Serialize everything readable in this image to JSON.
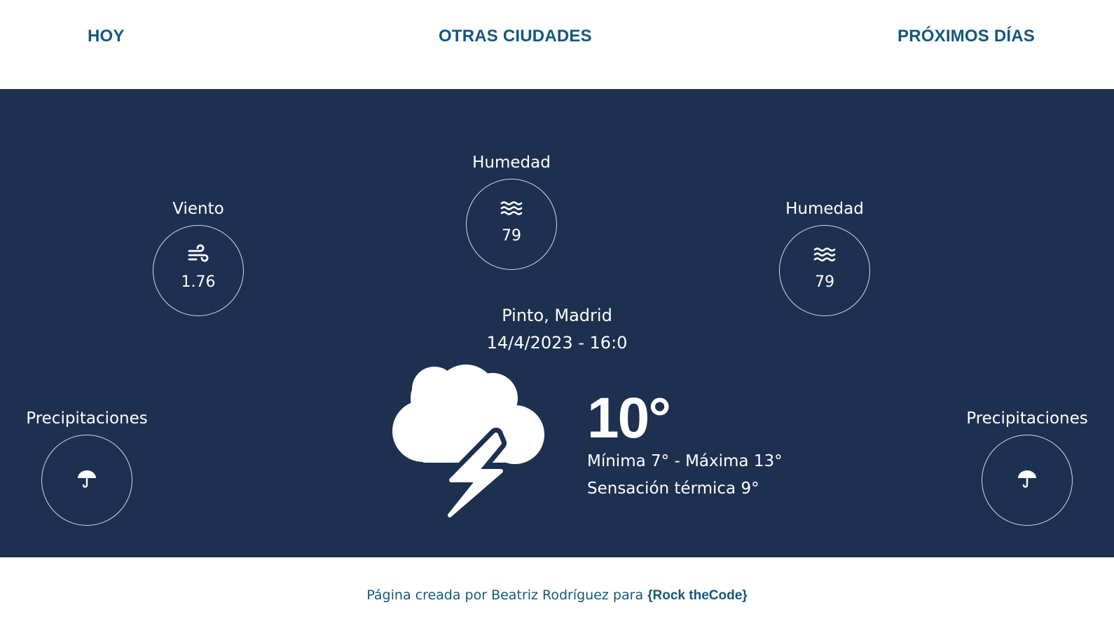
{
  "nav": {
    "today": "HOY",
    "other_cities": "OTRAS CIUDADES",
    "next_days": "PRÓXIMOS DÍAS"
  },
  "stats": {
    "wind": {
      "label": "Viento",
      "value": "1.76",
      "icon": "wind-icon"
    },
    "humidity_center": {
      "label": "Humedad",
      "value": "79",
      "icon": "humidity-waves-icon"
    },
    "humidity_right": {
      "label": "Humedad",
      "value": "79",
      "icon": "humidity-waves-icon"
    },
    "precip_left": {
      "label": "Precipitaciones",
      "icon": "umbrella-icon"
    },
    "precip_right": {
      "label": "Precipitaciones",
      "icon": "umbrella-icon"
    }
  },
  "weather": {
    "location": "Pinto, Madrid",
    "datetime": "14/4/2023 - 16:0",
    "icon": "thunderstorm-cloud-icon",
    "temperature": "10°",
    "min_max": "Mínima 7° - Máxima 13°",
    "feels_like": "Sensación térmica 9°"
  },
  "footer": {
    "text": "Página creada por Beatriz Rodríguez para",
    "brand": "{Rock theCode}"
  },
  "colors": {
    "primary_bg": "#1e3050",
    "nav_text": "#14577e",
    "circle_border": "#d6dbe4",
    "white": "#ffffff"
  }
}
